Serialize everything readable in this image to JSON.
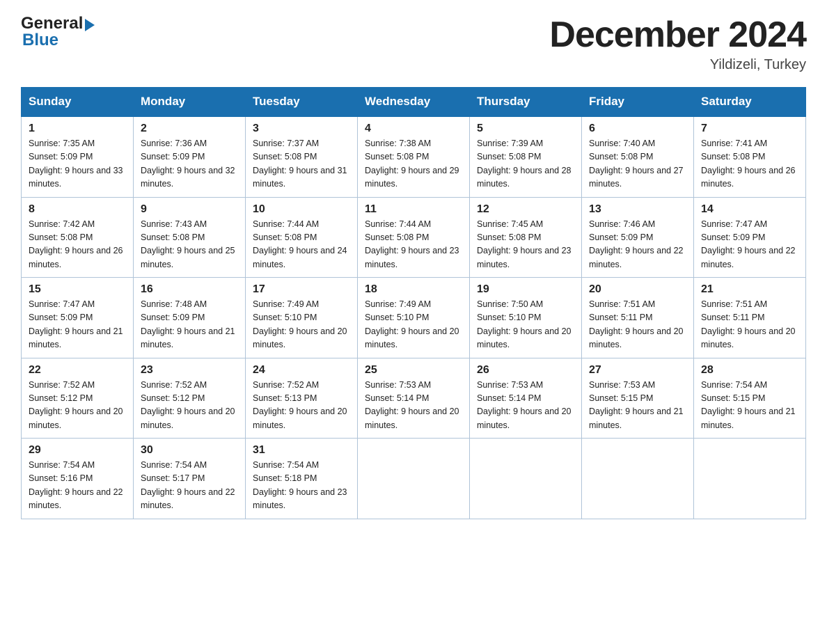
{
  "header": {
    "month_title": "December 2024",
    "location": "Yildizeli, Turkey",
    "logo_general": "General",
    "logo_blue": "Blue"
  },
  "days_of_week": [
    "Sunday",
    "Monday",
    "Tuesday",
    "Wednesday",
    "Thursday",
    "Friday",
    "Saturday"
  ],
  "weeks": [
    [
      {
        "day": "1",
        "sunrise": "7:35 AM",
        "sunset": "5:09 PM",
        "daylight": "9 hours and 33 minutes."
      },
      {
        "day": "2",
        "sunrise": "7:36 AM",
        "sunset": "5:09 PM",
        "daylight": "9 hours and 32 minutes."
      },
      {
        "day": "3",
        "sunrise": "7:37 AM",
        "sunset": "5:08 PM",
        "daylight": "9 hours and 31 minutes."
      },
      {
        "day": "4",
        "sunrise": "7:38 AM",
        "sunset": "5:08 PM",
        "daylight": "9 hours and 29 minutes."
      },
      {
        "day": "5",
        "sunrise": "7:39 AM",
        "sunset": "5:08 PM",
        "daylight": "9 hours and 28 minutes."
      },
      {
        "day": "6",
        "sunrise": "7:40 AM",
        "sunset": "5:08 PM",
        "daylight": "9 hours and 27 minutes."
      },
      {
        "day": "7",
        "sunrise": "7:41 AM",
        "sunset": "5:08 PM",
        "daylight": "9 hours and 26 minutes."
      }
    ],
    [
      {
        "day": "8",
        "sunrise": "7:42 AM",
        "sunset": "5:08 PM",
        "daylight": "9 hours and 26 minutes."
      },
      {
        "day": "9",
        "sunrise": "7:43 AM",
        "sunset": "5:08 PM",
        "daylight": "9 hours and 25 minutes."
      },
      {
        "day": "10",
        "sunrise": "7:44 AM",
        "sunset": "5:08 PM",
        "daylight": "9 hours and 24 minutes."
      },
      {
        "day": "11",
        "sunrise": "7:44 AM",
        "sunset": "5:08 PM",
        "daylight": "9 hours and 23 minutes."
      },
      {
        "day": "12",
        "sunrise": "7:45 AM",
        "sunset": "5:08 PM",
        "daylight": "9 hours and 23 minutes."
      },
      {
        "day": "13",
        "sunrise": "7:46 AM",
        "sunset": "5:09 PM",
        "daylight": "9 hours and 22 minutes."
      },
      {
        "day": "14",
        "sunrise": "7:47 AM",
        "sunset": "5:09 PM",
        "daylight": "9 hours and 22 minutes."
      }
    ],
    [
      {
        "day": "15",
        "sunrise": "7:47 AM",
        "sunset": "5:09 PM",
        "daylight": "9 hours and 21 minutes."
      },
      {
        "day": "16",
        "sunrise": "7:48 AM",
        "sunset": "5:09 PM",
        "daylight": "9 hours and 21 minutes."
      },
      {
        "day": "17",
        "sunrise": "7:49 AM",
        "sunset": "5:10 PM",
        "daylight": "9 hours and 20 minutes."
      },
      {
        "day": "18",
        "sunrise": "7:49 AM",
        "sunset": "5:10 PM",
        "daylight": "9 hours and 20 minutes."
      },
      {
        "day": "19",
        "sunrise": "7:50 AM",
        "sunset": "5:10 PM",
        "daylight": "9 hours and 20 minutes."
      },
      {
        "day": "20",
        "sunrise": "7:51 AM",
        "sunset": "5:11 PM",
        "daylight": "9 hours and 20 minutes."
      },
      {
        "day": "21",
        "sunrise": "7:51 AM",
        "sunset": "5:11 PM",
        "daylight": "9 hours and 20 minutes."
      }
    ],
    [
      {
        "day": "22",
        "sunrise": "7:52 AM",
        "sunset": "5:12 PM",
        "daylight": "9 hours and 20 minutes."
      },
      {
        "day": "23",
        "sunrise": "7:52 AM",
        "sunset": "5:12 PM",
        "daylight": "9 hours and 20 minutes."
      },
      {
        "day": "24",
        "sunrise": "7:52 AM",
        "sunset": "5:13 PM",
        "daylight": "9 hours and 20 minutes."
      },
      {
        "day": "25",
        "sunrise": "7:53 AM",
        "sunset": "5:14 PM",
        "daylight": "9 hours and 20 minutes."
      },
      {
        "day": "26",
        "sunrise": "7:53 AM",
        "sunset": "5:14 PM",
        "daylight": "9 hours and 20 minutes."
      },
      {
        "day": "27",
        "sunrise": "7:53 AM",
        "sunset": "5:15 PM",
        "daylight": "9 hours and 21 minutes."
      },
      {
        "day": "28",
        "sunrise": "7:54 AM",
        "sunset": "5:15 PM",
        "daylight": "9 hours and 21 minutes."
      }
    ],
    [
      {
        "day": "29",
        "sunrise": "7:54 AM",
        "sunset": "5:16 PM",
        "daylight": "9 hours and 22 minutes."
      },
      {
        "day": "30",
        "sunrise": "7:54 AM",
        "sunset": "5:17 PM",
        "daylight": "9 hours and 22 minutes."
      },
      {
        "day": "31",
        "sunrise": "7:54 AM",
        "sunset": "5:18 PM",
        "daylight": "9 hours and 23 minutes."
      },
      null,
      null,
      null,
      null
    ]
  ]
}
